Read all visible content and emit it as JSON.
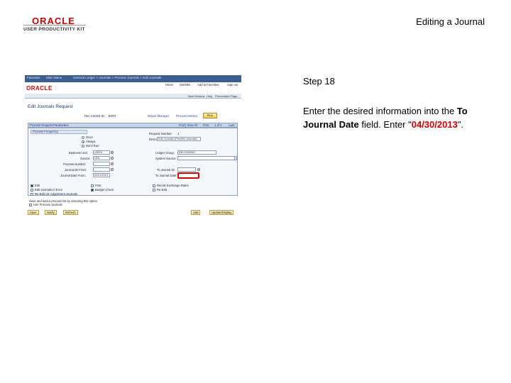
{
  "header": {
    "logo_oracle": "ORACLE",
    "logo_upk": "USER PRODUCTIVITY KIT",
    "title": "Editing a Journal"
  },
  "step": {
    "label": "Step 18"
  },
  "instruction": {
    "part1": "Enter the desired information into the ",
    "field_name": "To Journal Date",
    "part2": " field. Enter \"",
    "value": "04/30/2013",
    "part3": "\"."
  },
  "screenshot": {
    "nav_items": [
      "Favorites",
      "Main Menu",
      "General Ledger > Journals > Process Journals > Edit Journals"
    ],
    "oracle_logo": "ORACLE",
    "top_links": [
      "Home",
      "Worklist",
      "Add to Favorites",
      "Sign out"
    ],
    "bar_links": [
      "New Window",
      "Help",
      "Personalize Page"
    ],
    "page_title": "Edit Journals Request",
    "run_control_label": "Run Control ID:",
    "run_control_value": "JEDIT",
    "report_manager": "Report Manager",
    "process_monitor": "Process Monitor",
    "run_button": "Run",
    "grid_header": "Process Request Parameters",
    "grid_find": "Find | View All",
    "grid_first": "First",
    "grid_count": "1 of 1",
    "grid_last": "Last",
    "process_frequency": "Process Frequency",
    "freq_options": [
      "Once",
      "Always",
      "Don't Run"
    ],
    "request_number_label": "Request Number:",
    "request_number_value": "1",
    "description_label": "Description:",
    "description_value": "Edit Journals (Process Journals)",
    "business_unit_label": "Business Unit:",
    "business_unit_value": "US001",
    "ledger_group_label": "Ledger Group:",
    "ledger_group_value": "RECORDING",
    "source_label": "Source:",
    "source_value": "ONL",
    "system_source_label": "System Source:",
    "process_number_label": "Process Number:",
    "from_journal_id_label": "Journal ID From:",
    "to_journal_id_label": "To Journal ID:",
    "from_date_label": "Journal Date From:",
    "from_date_value": "04/01/2013",
    "to_date_label": "To Journal Date:",
    "edit_checks": [
      "Edit",
      "Post",
      "Recalc Exchange Rates",
      "Edit Journals in Error",
      "Budget Check",
      "Re-Edit",
      "Re-Edit CE Adjustment Journals"
    ],
    "footer_note": "Save and load a process list by selecting this option",
    "footer_check": "Use Process Journals",
    "buttons": [
      "Save",
      "Notify",
      "Refresh",
      "Add",
      "Update/Display"
    ]
  }
}
